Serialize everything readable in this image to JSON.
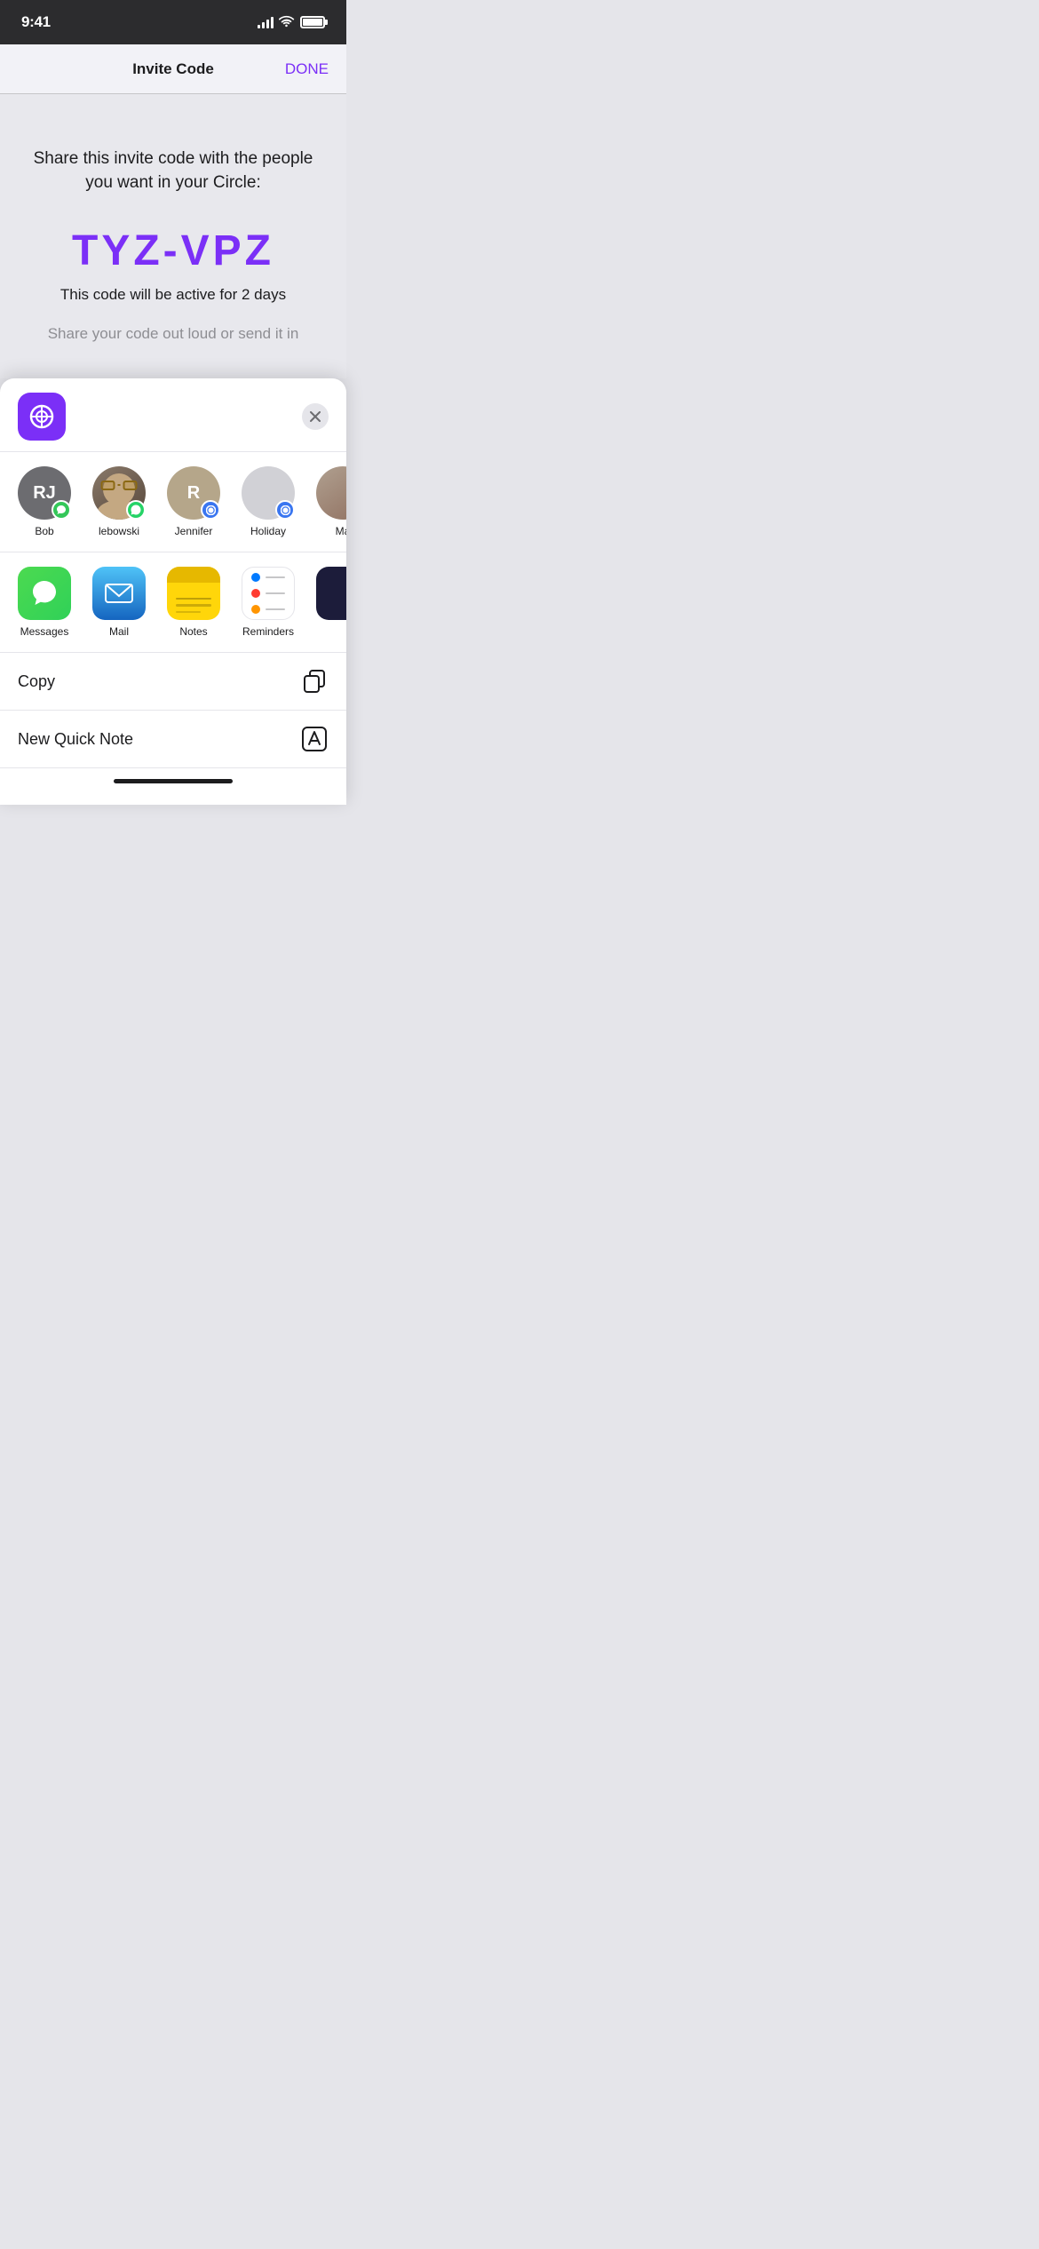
{
  "statusBar": {
    "time": "9:41",
    "signalBars": [
      4,
      7,
      10,
      13
    ],
    "battery": 100
  },
  "navBar": {
    "title": "Invite Code",
    "doneLabel": "DONE"
  },
  "inviteSection": {
    "description": "Share this invite code with the people you want in your Circle:",
    "code": "TYZ-VPZ",
    "expiry": "This code will be active for 2 days",
    "hint": "Share your code out loud or send it in"
  },
  "shareSheet": {
    "closeLabel": "×",
    "contacts": [
      {
        "id": "bob",
        "initials": "RJ",
        "name": "Bob",
        "badge": "messages"
      },
      {
        "id": "lebowski",
        "initials": "",
        "name": "lebowski",
        "badge": "whatsapp"
      },
      {
        "id": "jennifer",
        "initials": "R",
        "name": "Jennifer",
        "badge": "signal"
      },
      {
        "id": "holiday",
        "initials": "",
        "name": "Holiday",
        "badge": "signal"
      },
      {
        "id": "ma",
        "initials": "",
        "name": "Ma",
        "badge": "none"
      }
    ],
    "apps": [
      {
        "id": "messages",
        "name": "Messages"
      },
      {
        "id": "mail",
        "name": "Mail"
      },
      {
        "id": "notes",
        "name": "Notes"
      },
      {
        "id": "reminders",
        "name": "Reminders"
      },
      {
        "id": "partial",
        "name": ""
      }
    ],
    "actions": [
      {
        "id": "copy",
        "label": "Copy",
        "icon": "copy"
      },
      {
        "id": "new-quick-note",
        "label": "New Quick Note",
        "icon": "quick-note"
      }
    ]
  }
}
